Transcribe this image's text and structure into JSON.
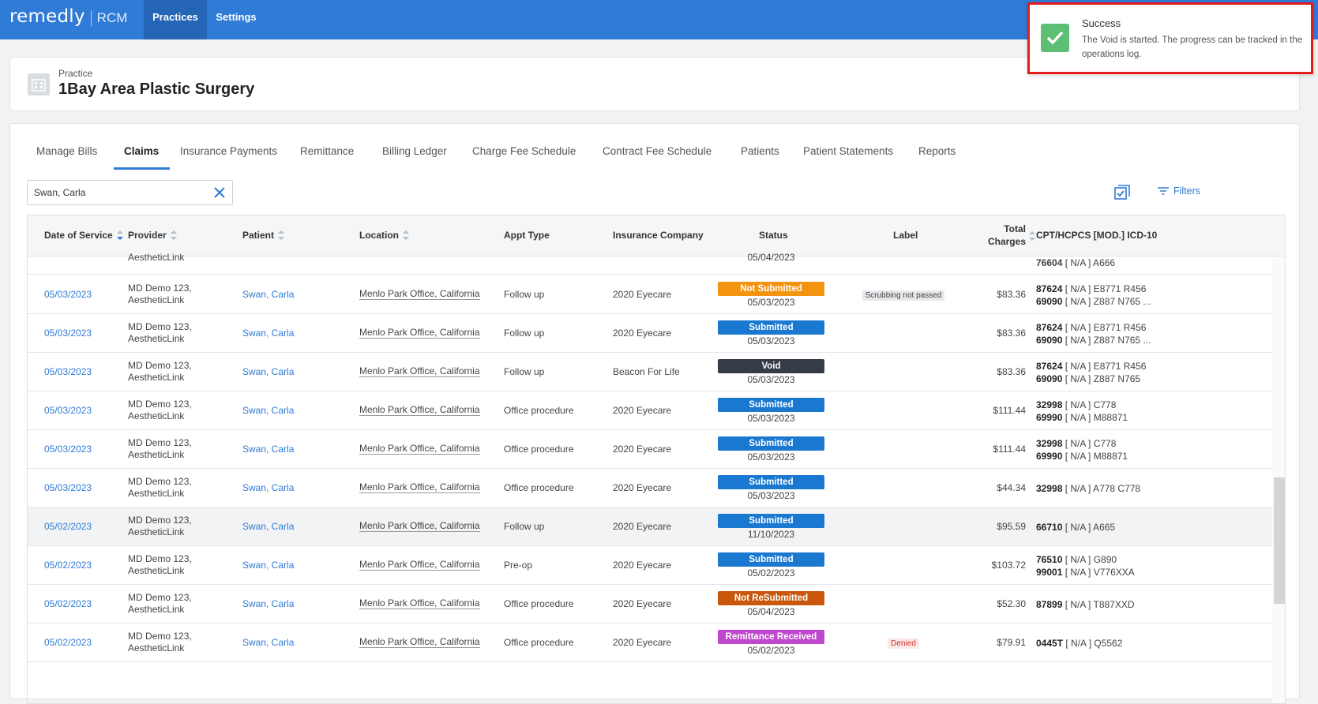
{
  "brand": {
    "name": "remedly",
    "product": "RCM"
  },
  "topnav": {
    "items": [
      {
        "label": "Practices",
        "active": true
      },
      {
        "label": "Settings",
        "active": false
      }
    ]
  },
  "toast": {
    "title": "Success",
    "message": "The Void is started. The progress can be tracked in the operations log.",
    "icon": "check-icon"
  },
  "practice": {
    "label": "Practice",
    "name": "1Bay Area Plastic Surgery"
  },
  "tabs": [
    {
      "label": "Manage Bills"
    },
    {
      "label": "Claims",
      "active": true
    },
    {
      "label": "Insurance Payments"
    },
    {
      "label": "Remittance"
    },
    {
      "label": "Billing Ledger"
    },
    {
      "label": "Charge Fee Schedule"
    },
    {
      "label": "Contract Fee Schedule"
    },
    {
      "label": "Patients"
    },
    {
      "label": "Patient Statements"
    },
    {
      "label": "Reports"
    }
  ],
  "search": {
    "value": "Swan, Carla"
  },
  "toolbar": {
    "filters_label": "Filters"
  },
  "table": {
    "columns": {
      "date": "Date of Service",
      "provider": "Provider",
      "patient": "Patient",
      "location": "Location",
      "appt": "Appt Type",
      "insurance": "Insurance Company",
      "status": "Status",
      "label": "Label",
      "charges_1": "Total",
      "charges_2": "Charges",
      "cpt": "CPT/HCPCS [MOD.] ICD-10"
    },
    "partial_row": {
      "provider": "AestheticLink",
      "status_date": "05/04/2023",
      "cpt_code": "76604",
      "cpt_rest": " [ N/A ] A666"
    },
    "rows": [
      {
        "date": "05/03/2023",
        "provider_1": "MD Demo 123,",
        "provider_2": "AestheticLink",
        "patient": "Swan, Carla",
        "location": "Menlo Park Office, California",
        "appt": "Follow up",
        "insurance": "2020 Eyecare",
        "status": "Not Submitted",
        "status_color": "#f39410",
        "status_date": "05/03/2023",
        "label": "Scrubbing not passed",
        "label_style": "gray",
        "charges": "$83.36",
        "cpt1_code": "87624",
        "cpt1_rest": " [ N/A ] E8771 R456",
        "cpt2_code": "69090",
        "cpt2_rest": " [ N/A ] Z887 N765 ..."
      },
      {
        "date": "05/03/2023",
        "provider_1": "MD Demo 123,",
        "provider_2": "AestheticLink",
        "patient": "Swan, Carla",
        "location": "Menlo Park Office, California",
        "appt": "Follow up",
        "insurance": "2020 Eyecare",
        "status": "Submitted",
        "status_color": "#1a78d0",
        "status_date": "05/03/2023",
        "label": "",
        "label_style": "",
        "charges": "$83.36",
        "cpt1_code": "87624",
        "cpt1_rest": " [ N/A ] E8771 R456",
        "cpt2_code": "69090",
        "cpt2_rest": " [ N/A ] Z887 N765 ..."
      },
      {
        "date": "05/03/2023",
        "provider_1": "MD Demo 123,",
        "provider_2": "AestheticLink",
        "patient": "Swan, Carla",
        "location": "Menlo Park Office, California",
        "appt": "Follow up",
        "insurance": "Beacon For Life",
        "status": "Void",
        "status_color": "#353c48",
        "status_date": "05/03/2023",
        "label": "",
        "label_style": "",
        "charges": "$83.36",
        "cpt1_code": "87624",
        "cpt1_rest": " [ N/A ] E8771 R456",
        "cpt2_code": "69090",
        "cpt2_rest": " [ N/A ] Z887 N765"
      },
      {
        "date": "05/03/2023",
        "provider_1": "MD Demo 123,",
        "provider_2": "AestheticLink",
        "patient": "Swan, Carla",
        "location": "Menlo Park Office, California",
        "appt": "Office procedure",
        "insurance": "2020 Eyecare",
        "status": "Submitted",
        "status_color": "#1a78d0",
        "status_date": "05/03/2023",
        "label": "",
        "label_style": "",
        "charges": "$111.44",
        "cpt1_code": "32998",
        "cpt1_rest": " [ N/A ] C778",
        "cpt2_code": "69990",
        "cpt2_rest": " [ N/A ] M88871"
      },
      {
        "date": "05/03/2023",
        "provider_1": "MD Demo 123,",
        "provider_2": "AestheticLink",
        "patient": "Swan, Carla",
        "location": "Menlo Park Office, California",
        "appt": "Office procedure",
        "insurance": "2020 Eyecare",
        "status": "Submitted",
        "status_color": "#1a78d0",
        "status_date": "05/03/2023",
        "label": "",
        "label_style": "",
        "charges": "$111.44",
        "cpt1_code": "32998",
        "cpt1_rest": " [ N/A ] C778",
        "cpt2_code": "69990",
        "cpt2_rest": " [ N/A ] M88871"
      },
      {
        "date": "05/03/2023",
        "provider_1": "MD Demo 123,",
        "provider_2": "AestheticLink",
        "patient": "Swan, Carla",
        "location": "Menlo Park Office, California",
        "appt": "Office procedure",
        "insurance": "2020 Eyecare",
        "status": "Submitted",
        "status_color": "#1a78d0",
        "status_date": "05/03/2023",
        "label": "",
        "label_style": "",
        "charges": "$44.34",
        "cpt1_code": "32998",
        "cpt1_rest": " [ N/A ] A778 C778",
        "cpt2_code": "",
        "cpt2_rest": ""
      },
      {
        "date": "05/02/2023",
        "provider_1": "MD Demo 123,",
        "provider_2": "AestheticLink",
        "patient": "Swan, Carla",
        "location": "Menlo Park Office, California",
        "appt": "Follow up",
        "insurance": "2020 Eyecare",
        "status": "Submitted",
        "status_color": "#1a78d0",
        "status_date": "11/10/2023",
        "label": "",
        "label_style": "",
        "charges": "$95.59",
        "cpt1_code": "66710",
        "cpt1_rest": " [ N/A ] A665",
        "cpt2_code": "",
        "cpt2_rest": "",
        "highlight": true
      },
      {
        "date": "05/02/2023",
        "provider_1": "MD Demo 123,",
        "provider_2": "AestheticLink",
        "patient": "Swan, Carla",
        "location": "Menlo Park Office, California",
        "appt": "Pre-op",
        "insurance": "2020 Eyecare",
        "status": "Submitted",
        "status_color": "#1a78d0",
        "status_date": "05/02/2023",
        "label": "",
        "label_style": "",
        "charges": "$103.72",
        "cpt1_code": "76510",
        "cpt1_rest": " [ N/A ] G890",
        "cpt2_code": "99001",
        "cpt2_rest": " [ N/A ] V776XXA"
      },
      {
        "date": "05/02/2023",
        "provider_1": "MD Demo 123,",
        "provider_2": "AestheticLink",
        "patient": "Swan, Carla",
        "location": "Menlo Park Office, California",
        "appt": "Office procedure",
        "insurance": "2020 Eyecare",
        "status": "Not ReSubmitted",
        "status_color": "#c9580d",
        "status_date": "05/04/2023",
        "label": "",
        "label_style": "",
        "charges": "$52.30",
        "cpt1_code": "87899",
        "cpt1_rest": " [ N/A ] T887XXD",
        "cpt2_code": "",
        "cpt2_rest": ""
      },
      {
        "date": "05/02/2023",
        "provider_1": "MD Demo 123,",
        "provider_2": "AestheticLink",
        "patient": "Swan, Carla",
        "location": "Menlo Park Office, California",
        "appt": "Office procedure",
        "insurance": "2020 Eyecare",
        "status": "Remittance Received",
        "status_color": "#bf48cf",
        "status_date": "05/02/2023",
        "label": "Denied",
        "label_style": "red",
        "charges": "$79.91",
        "cpt1_code": "0445T",
        "cpt1_rest": " [ N/A ] Q5562",
        "cpt2_code": "",
        "cpt2_rest": ""
      }
    ]
  }
}
